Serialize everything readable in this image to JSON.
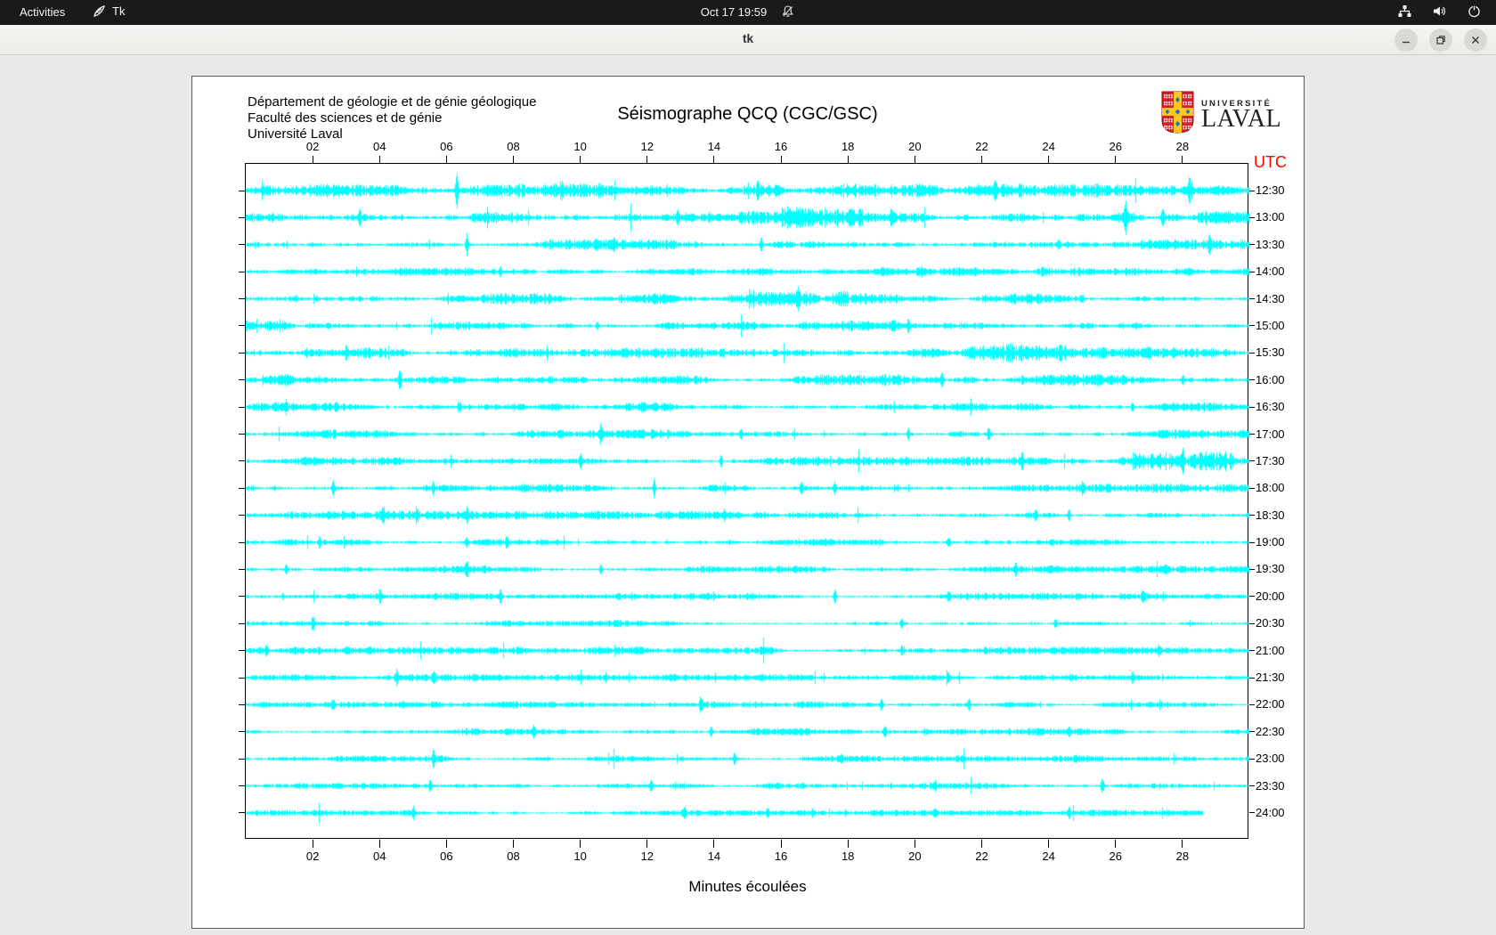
{
  "topbar": {
    "activities_label": "Activities",
    "app_label": "Tk",
    "clock": "Oct 17  19:59",
    "icons": [
      "tk-feather-icon",
      "notifications-muted-icon",
      "wired-network-icon",
      "volume-icon",
      "power-icon"
    ]
  },
  "titlebar": {
    "title": "tk",
    "buttons": [
      "minimize",
      "maximize",
      "close"
    ]
  },
  "canvas": {
    "header_lines": [
      "Département de géologie et de génie géologique",
      "Faculté des sciences et de génie",
      "Université Laval"
    ],
    "title": "Séismographe QCQ (CGC/GSC)",
    "logo": {
      "small": "UNIVERSITÉ",
      "large": "LAVAL"
    },
    "utc_header": "UTC",
    "xlabel": "Minutes écoulées",
    "colors": {
      "trace": "#00ffff",
      "utc_label": "#ff0000",
      "axis": "#000000",
      "logo_red": "#d71f2b",
      "logo_gold": "#ffc61e",
      "logo_blue": "#1472b8"
    }
  },
  "chart_data": {
    "type": "line",
    "subtype": "helicorder-seismogram",
    "station": "QCQ (CGC/GSC)",
    "xlabel": "Minutes écoulées",
    "x_range_minutes": [
      0,
      30
    ],
    "x_ticks": [
      "02",
      "04",
      "06",
      "08",
      "10",
      "12",
      "14",
      "16",
      "18",
      "20",
      "22",
      "24",
      "26",
      "28"
    ],
    "x_tick_minutes": [
      2,
      4,
      6,
      8,
      10,
      12,
      14,
      16,
      18,
      20,
      22,
      24,
      26,
      28
    ],
    "right_axis_title": "UTC",
    "legend_position": "none",
    "grid": false,
    "rows": [
      {
        "utc": "12:30",
        "amp": 3.0,
        "end": 30,
        "seed": 1001,
        "bursts": [
          [
            8,
            9.5,
            1.7
          ],
          [
            14.8,
            16,
            1.4
          ]
        ],
        "spikes": [
          [
            0.5,
            6
          ],
          [
            6.3,
            20
          ],
          [
            15.3,
            9
          ],
          [
            22.4,
            7
          ],
          [
            28.2,
            11
          ]
        ]
      },
      {
        "utc": "13:00",
        "amp": 3.2,
        "end": 30,
        "seed": 1102,
        "bursts": [
          [
            3,
            4.2,
            1.6
          ],
          [
            16,
            18.5,
            1.6
          ]
        ],
        "spikes": [
          [
            3.4,
            10
          ],
          [
            12.9,
            8
          ],
          [
            19.3,
            10
          ],
          [
            26.3,
            17
          ],
          [
            27.4,
            12
          ]
        ]
      },
      {
        "utc": "13:30",
        "amp": 2.4,
        "end": 30,
        "seed": 1203,
        "bursts": [],
        "spikes": [
          [
            6.6,
            13
          ],
          [
            11.0,
            6
          ],
          [
            15.4,
            10
          ],
          [
            24.3,
            6
          ],
          [
            28.8,
            8
          ]
        ]
      },
      {
        "utc": "14:00",
        "amp": 2.0,
        "end": 30,
        "seed": 1304,
        "bursts": [],
        "spikes": [
          [
            7.6,
            7
          ],
          [
            20.2,
            6
          ],
          [
            23.8,
            5
          ]
        ]
      },
      {
        "utc": "14:30",
        "amp": 2.6,
        "end": 30,
        "seed": 1405,
        "bursts": [
          [
            2,
            3.5,
            1.6
          ],
          [
            15,
            18,
            2.5
          ]
        ],
        "spikes": [
          [
            16.5,
            9
          ],
          [
            25.0,
            5
          ]
        ]
      },
      {
        "utc": "15:00",
        "amp": 2.6,
        "end": 30,
        "seed": 1506,
        "bursts": [
          [
            0,
            1.2,
            1.8
          ]
        ],
        "spikes": [
          [
            10.5,
            5
          ],
          [
            19.8,
            6
          ]
        ]
      },
      {
        "utc": "15:30",
        "amp": 2.5,
        "end": 30,
        "seed": 1607,
        "bursts": [
          [
            21.5,
            24.5,
            1.9
          ]
        ],
        "spikes": [
          [
            3.0,
            6
          ],
          [
            9.0,
            5
          ],
          [
            27.0,
            6
          ]
        ]
      },
      {
        "utc": "16:00",
        "amp": 2.6,
        "end": 30,
        "seed": 1708,
        "bursts": [
          [
            0.5,
            2.2,
            2.3
          ]
        ],
        "spikes": [
          [
            4.6,
            12
          ],
          [
            20.8,
            8
          ],
          [
            28.0,
            5
          ]
        ]
      },
      {
        "utc": "16:30",
        "amp": 2.2,
        "end": 30,
        "seed": 1809,
        "bursts": [],
        "spikes": [
          [
            1.2,
            6
          ],
          [
            6.4,
            6
          ],
          [
            26.5,
            6
          ]
        ]
      },
      {
        "utc": "17:00",
        "amp": 2.2,
        "end": 30,
        "seed": 1910,
        "bursts": [
          [
            21,
            22.5,
            1.7
          ]
        ],
        "spikes": [
          [
            10.6,
            8
          ],
          [
            14.8,
            6
          ],
          [
            19.8,
            7
          ],
          [
            22.2,
            8
          ]
        ]
      },
      {
        "utc": "17:30",
        "amp": 2.0,
        "end": 30,
        "seed": 2011,
        "bursts": [
          [
            26.5,
            29.5,
            2.2
          ]
        ],
        "spikes": [
          [
            10.0,
            8
          ],
          [
            14.2,
            7
          ],
          [
            23.2,
            9
          ],
          [
            28.0,
            14
          ]
        ]
      },
      {
        "utc": "18:00",
        "amp": 2.0,
        "end": 30,
        "seed": 2112,
        "bursts": [],
        "spikes": [
          [
            2.6,
            8
          ],
          [
            5.6,
            7
          ],
          [
            12.2,
            11
          ],
          [
            16.6,
            7
          ],
          [
            17.6,
            8
          ],
          [
            25.0,
            7
          ]
        ]
      },
      {
        "utc": "18:30",
        "amp": 2.0,
        "end": 30,
        "seed": 2213,
        "bursts": [],
        "spikes": [
          [
            4.1,
            10
          ],
          [
            5.1,
            8
          ],
          [
            6.6,
            7
          ],
          [
            14.3,
            6
          ],
          [
            23.6,
            9
          ],
          [
            24.6,
            8
          ]
        ]
      },
      {
        "utc": "19:00",
        "amp": 1.8,
        "end": 30,
        "seed": 2314,
        "bursts": [],
        "spikes": [
          [
            2.2,
            7
          ],
          [
            6.6,
            6
          ],
          [
            7.8,
            5
          ],
          [
            21.0,
            7
          ]
        ]
      },
      {
        "utc": "19:30",
        "amp": 1.8,
        "end": 30,
        "seed": 2415,
        "bursts": [],
        "spikes": [
          [
            1.2,
            7
          ],
          [
            6.6,
            9
          ],
          [
            10.6,
            6
          ],
          [
            23.0,
            6
          ],
          [
            27.5,
            5
          ]
        ]
      },
      {
        "utc": "20:00",
        "amp": 1.7,
        "end": 30,
        "seed": 2516,
        "bursts": [],
        "spikes": [
          [
            4.0,
            7
          ],
          [
            7.6,
            8
          ],
          [
            17.6,
            7
          ],
          [
            21.0,
            6
          ],
          [
            26.8,
            5
          ]
        ]
      },
      {
        "utc": "20:30",
        "amp": 1.6,
        "end": 30,
        "seed": 2617,
        "bursts": [],
        "spikes": [
          [
            2.0,
            8
          ],
          [
            19.6,
            7
          ],
          [
            24.2,
            5
          ]
        ]
      },
      {
        "utc": "21:00",
        "amp": 1.8,
        "end": 30,
        "seed": 2718,
        "bursts": [
          [
            13.5,
            16,
            1.6
          ]
        ],
        "spikes": [
          [
            0.6,
            7
          ],
          [
            19.6,
            6
          ],
          [
            27.3,
            5
          ]
        ]
      },
      {
        "utc": "21:30",
        "amp": 1.6,
        "end": 30,
        "seed": 2819,
        "bursts": [],
        "spikes": [
          [
            4.5,
            9
          ],
          [
            5.6,
            7
          ],
          [
            21.0,
            6
          ],
          [
            26.5,
            5
          ]
        ]
      },
      {
        "utc": "22:00",
        "amp": 1.5,
        "end": 30,
        "seed": 2920,
        "bursts": [],
        "spikes": [
          [
            2.6,
            7
          ],
          [
            13.6,
            8
          ],
          [
            19.0,
            7
          ],
          [
            21.6,
            6
          ]
        ]
      },
      {
        "utc": "22:30",
        "amp": 1.6,
        "end": 30,
        "seed": 3021,
        "bursts": [],
        "spikes": [
          [
            8.6,
            8
          ],
          [
            13.9,
            7
          ],
          [
            19.1,
            8
          ],
          [
            24.6,
            5
          ]
        ]
      },
      {
        "utc": "23:00",
        "amp": 1.5,
        "end": 30,
        "seed": 3122,
        "bursts": [],
        "spikes": [
          [
            5.6,
            8
          ],
          [
            14.6,
            7
          ],
          [
            17.8,
            6
          ],
          [
            24.8,
            5
          ]
        ]
      },
      {
        "utc": "23:30",
        "amp": 1.5,
        "end": 30,
        "seed": 3223,
        "bursts": [],
        "spikes": [
          [
            5.5,
            7
          ],
          [
            12.1,
            6
          ],
          [
            20.6,
            5
          ],
          [
            25.6,
            10
          ]
        ]
      },
      {
        "utc": "24:00",
        "amp": 1.5,
        "end": 28.6,
        "seed": 3324,
        "bursts": [],
        "spikes": [
          [
            5.0,
            6
          ],
          [
            13.1,
            7
          ],
          [
            15.6,
            6
          ],
          [
            20.6,
            5
          ],
          [
            24.6,
            6
          ]
        ]
      }
    ]
  }
}
